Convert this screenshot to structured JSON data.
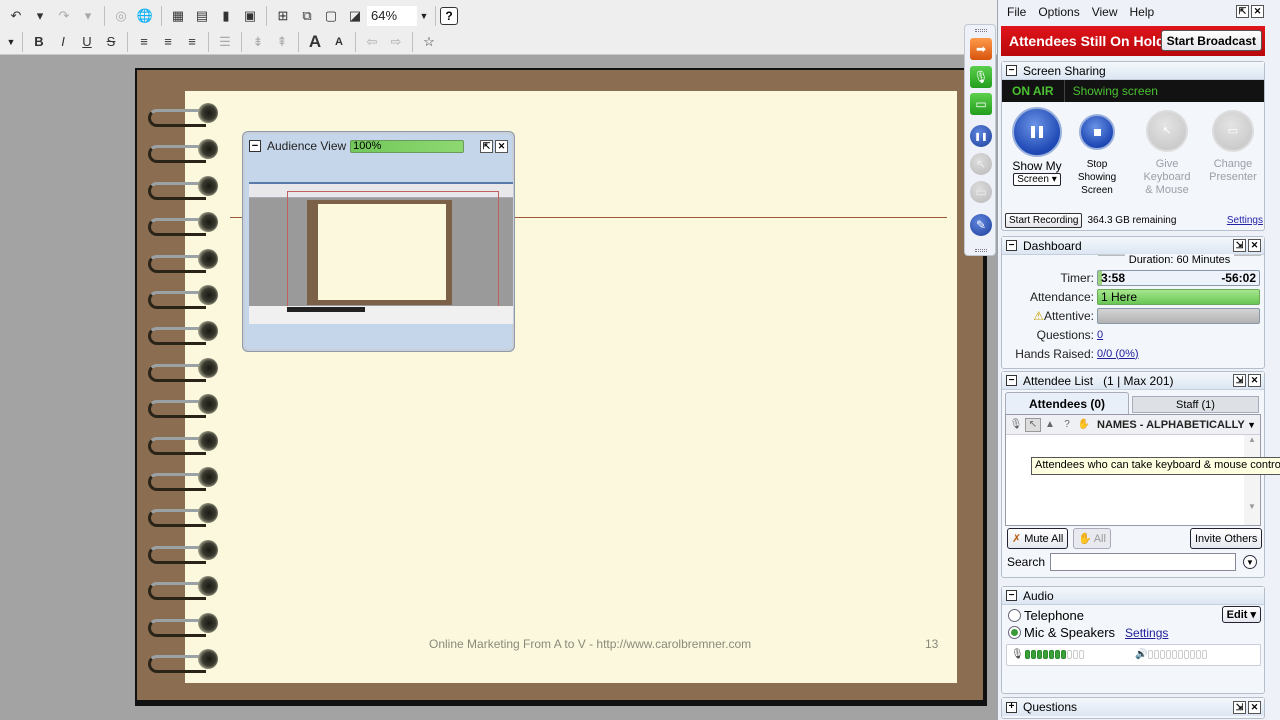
{
  "toolbar": {
    "row1": [
      {
        "name": "undo-icon",
        "glyph": "↶"
      },
      {
        "name": "undo-dropdown-icon",
        "glyph": "▾"
      },
      {
        "name": "redo-icon",
        "glyph": "↷",
        "dim": true
      },
      {
        "name": "redo-dropdown-icon",
        "glyph": "▾",
        "dim": true
      },
      {
        "name": "web-link-icon",
        "glyph": "◎",
        "dim": true
      },
      {
        "name": "globe-icon",
        "glyph": "🌐"
      },
      {
        "name": "insert-table-icon",
        "glyph": "▦"
      },
      {
        "name": "edit-table-icon",
        "glyph": "▤"
      },
      {
        "name": "chart-icon",
        "glyph": "▮"
      },
      {
        "name": "image-icon",
        "glyph": "▣"
      },
      {
        "name": "new-slide-icon",
        "glyph": "⊞"
      },
      {
        "name": "duplicate-slide-icon",
        "glyph": "⧉"
      },
      {
        "name": "background-icon",
        "glyph": "▢"
      },
      {
        "name": "color-fill-icon",
        "glyph": "◪"
      }
    ],
    "zoom_value": "64%",
    "help_label": "?",
    "row2": [
      {
        "name": "bold-icon",
        "glyph": "B"
      },
      {
        "name": "italic-icon",
        "glyph": "I"
      },
      {
        "name": "underline-icon",
        "glyph": "U"
      },
      {
        "name": "strikethrough-icon",
        "glyph": "S"
      },
      {
        "name": "align-left-icon",
        "glyph": "≡"
      },
      {
        "name": "align-center-icon",
        "glyph": "≡"
      },
      {
        "name": "align-right-icon",
        "glyph": "≡"
      },
      {
        "name": "bullet-list-icon",
        "glyph": "☰",
        "dim": true
      },
      {
        "name": "line-spacing-decrease-icon",
        "glyph": "⇟",
        "dim": true
      },
      {
        "name": "line-spacing-increase-icon",
        "glyph": "⇞",
        "dim": true
      },
      {
        "name": "font-grow-icon",
        "glyph": "A"
      },
      {
        "name": "font-shrink-icon",
        "glyph": "A"
      },
      {
        "name": "indent-left-icon",
        "glyph": "⇦",
        "dim": true
      },
      {
        "name": "indent-right-icon",
        "glyph": "⇨",
        "dim": true
      },
      {
        "name": "effects-star-icon",
        "glyph": "☆"
      }
    ]
  },
  "slide": {
    "footer_text": "Online Marketing From A to V - http://www.carolbremner.com",
    "page_number": "13",
    "rings": 16
  },
  "audience_view": {
    "title": "Audience View",
    "progress_label": "100%",
    "progress_fraction": 1.0
  },
  "float_bar": [
    {
      "name": "hide-panel-arrow-icon",
      "glyph": "➡",
      "style": "orange"
    },
    {
      "name": "microphone-icon",
      "glyph": "🎙",
      "style": "green"
    },
    {
      "name": "screen-share-icon",
      "glyph": "▭",
      "style": "green"
    },
    {
      "name": "pause-icon",
      "glyph": "❚❚",
      "style": "blue"
    },
    {
      "name": "keyboard-mouse-icon",
      "glyph": "↖",
      "style": "grey"
    },
    {
      "name": "change-presenter-icon",
      "glyph": "▭",
      "style": "grey"
    },
    {
      "name": "drawing-tools-icon",
      "glyph": "✎",
      "style": "blue"
    }
  ],
  "panel": {
    "menu": [
      "File",
      "Options",
      "View",
      "Help"
    ],
    "broadcast": {
      "status": "Attendees Still On Hold",
      "button": "Start Broadcast",
      "color": "#c8080e"
    },
    "screen_sharing": {
      "title": "Screen Sharing",
      "on_air": "ON AIR",
      "status": "Showing screen",
      "show_my": "Show My",
      "screen_dropdown": "Screen ▾",
      "stop_lines": [
        "Stop",
        "Showing",
        "Screen"
      ],
      "give_lines": [
        "Give",
        "Keyboard",
        "& Mouse"
      ],
      "change_lines": [
        "Change",
        "Presenter"
      ],
      "start_recording": "Start Recording",
      "remaining": "364.3 GB remaining",
      "settings": "Settings"
    },
    "dashboard": {
      "title": "Dashboard",
      "duration": "Duration: 60 Minutes",
      "timer_label": "Timer:",
      "timer_elapsed": "3:58",
      "timer_remaining": "-56:02",
      "attendance_label": "Attendance:",
      "attendance_value": "1 Here",
      "attentive_label": "Attentive:",
      "questions_label": "Questions:",
      "questions_value": "0",
      "hands_label": "Hands Raised:",
      "hands_value": "0/0 (0%)"
    },
    "attendee_list": {
      "title": "Attendee List",
      "count": "(1 | Max 201)",
      "tab_attendees": "Attendees (0)",
      "tab_staff": "Staff (1)",
      "sort_label": "NAMES - ALPHABETICALLY",
      "tooltip": "Attendees who can take keyboard & mouse control",
      "mute_all": "Mute All",
      "hands_all": "All",
      "invite": "Invite Others",
      "search_label": "Search",
      "search_value": ""
    },
    "audio": {
      "title": "Audio",
      "telephone": "Telephone",
      "mic_speakers": "Mic & Speakers",
      "mode": "Mic & Speakers",
      "settings": "Settings",
      "edit": "Edit ▾",
      "mic_level": 0.7,
      "speaker_level": 0.0
    },
    "questions": {
      "title": "Questions"
    }
  }
}
